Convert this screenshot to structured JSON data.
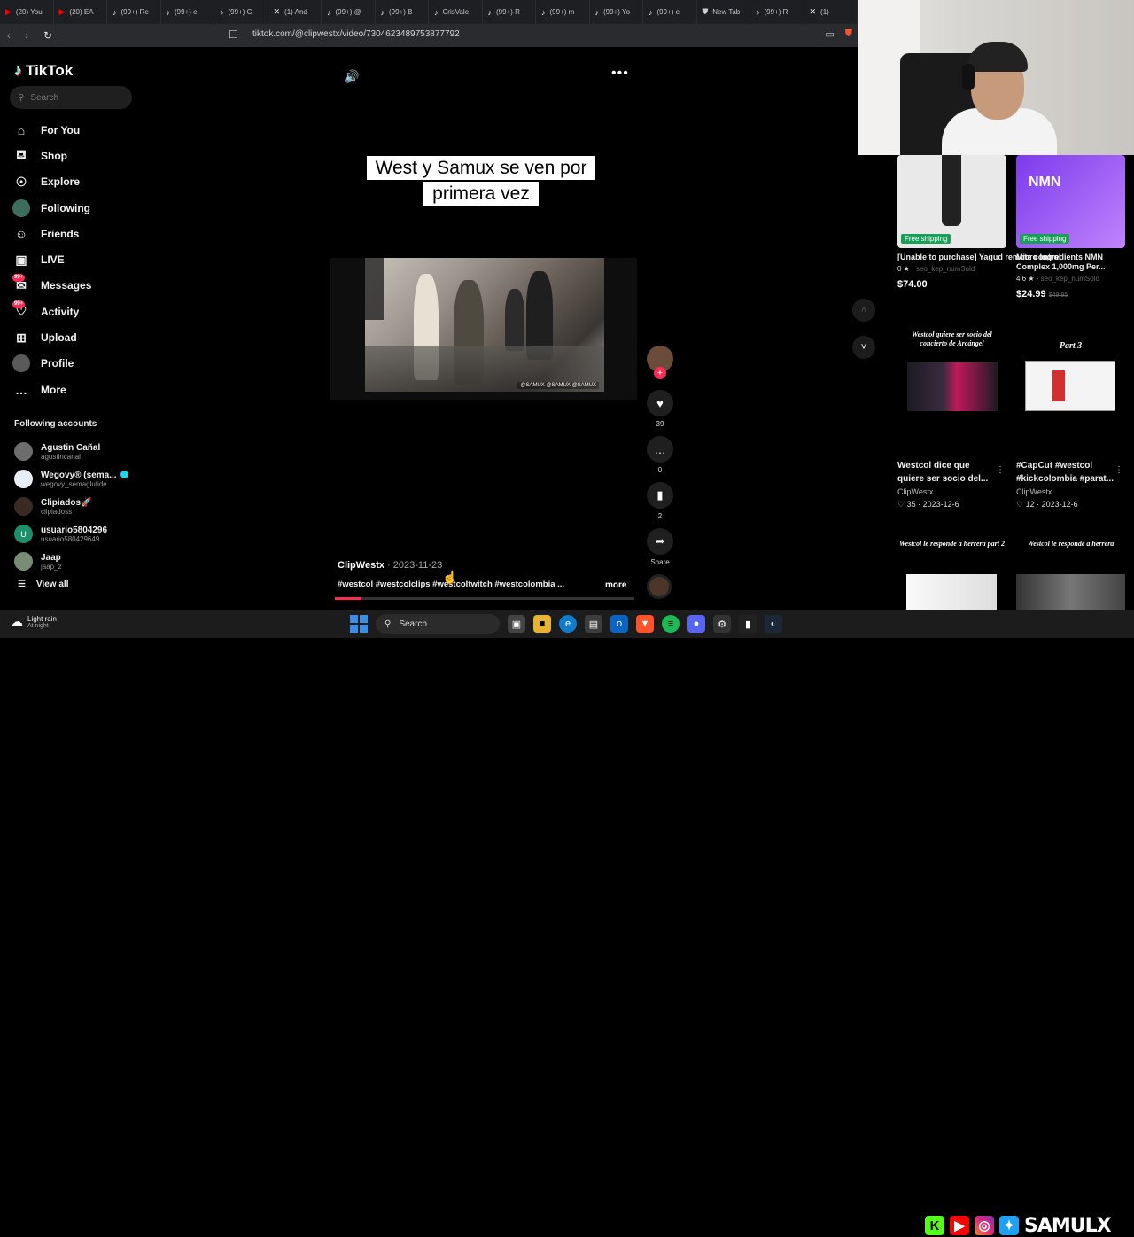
{
  "browser": {
    "tabs": [
      {
        "icon": "youtube-icon",
        "label": "(20) You",
        "color": "#ff0000"
      },
      {
        "icon": "youtube-icon",
        "label": "(20) EA",
        "color": "#ff0000"
      },
      {
        "icon": "tiktok-icon",
        "label": "(99+) Re",
        "color": "#ffffff"
      },
      {
        "icon": "tiktok-icon",
        "label": "(99+) el",
        "color": "#ffffff"
      },
      {
        "icon": "tiktok-icon",
        "label": "(99+) G",
        "color": "#ffffff"
      },
      {
        "icon": "x-icon",
        "label": "(1) And",
        "color": "#ffffff"
      },
      {
        "icon": "tiktok-icon",
        "label": "(99+) @",
        "color": "#ffffff"
      },
      {
        "icon": "tiktok-icon",
        "label": "(99+) B",
        "color": "#ffffff"
      },
      {
        "icon": "tiktok-icon",
        "label": "CrisVale",
        "color": "#ffffff"
      },
      {
        "icon": "tiktok-icon",
        "label": "(99+) R",
        "color": "#ffffff"
      },
      {
        "icon": "tiktok-icon",
        "label": "(99+) m",
        "color": "#ffffff"
      },
      {
        "icon": "tiktok-icon",
        "label": "(99+) Yo",
        "color": "#ffffff"
      },
      {
        "icon": "tiktok-icon",
        "label": "(99+) e",
        "color": "#ffffff"
      },
      {
        "icon": "brave-icon",
        "label": "New Tab",
        "color": "#cccccc"
      },
      {
        "icon": "tiktok-icon",
        "label": "(99+) R",
        "color": "#ffffff"
      },
      {
        "icon": "x-icon",
        "label": "(1)",
        "color": "#ffffff"
      }
    ],
    "url": "tiktok.com/@clipwestx/video/7304623489753877792"
  },
  "sidebar": {
    "logo": "TikTok",
    "search_placeholder": "Search",
    "menu": [
      {
        "label": "For You",
        "icon": "home-icon"
      },
      {
        "label": "Shop",
        "icon": "shopping-bag-icon"
      },
      {
        "label": "Explore",
        "icon": "compass-icon"
      },
      {
        "label": "Following",
        "icon": "following-avatar-icon"
      },
      {
        "label": "Friends",
        "icon": "friends-icon"
      },
      {
        "label": "LIVE",
        "icon": "live-icon"
      },
      {
        "label": "Messages",
        "icon": "messages-icon",
        "badge": "99+"
      },
      {
        "label": "Activity",
        "icon": "activity-icon",
        "badge": "99+"
      },
      {
        "label": "Upload",
        "icon": "upload-icon"
      },
      {
        "label": "Profile",
        "icon": "profile-avatar-icon"
      },
      {
        "label": "More",
        "icon": "more-icon"
      }
    ],
    "following_title": "Following accounts",
    "following": [
      {
        "name": "Agustin Cañal",
        "handle": "agustincanal",
        "verified": false
      },
      {
        "name": "Wegovy® (sema...",
        "handle": "wegovy_semaglutide",
        "verified": true
      },
      {
        "name": "Clipiados🚀",
        "handle": "clipiadoss",
        "verified": false
      },
      {
        "name": "usuario5804296",
        "handle": "usuario5804296​49",
        "verified": false,
        "initial": "U"
      },
      {
        "name": "Jaap",
        "handle": "jaap_z",
        "verified": false
      }
    ],
    "view_all": "View all"
  },
  "video": {
    "caption_line1": "West y Samux se ven por",
    "caption_line2": "primera vez",
    "watermark": "@SAMUX @SAMUX @SAMUX",
    "creator": "ClipWestx",
    "date": " · 2023-11-23",
    "hashtags": "#westcol #westcolclips #westcoltwitch #westcolombia ...",
    "more": "more",
    "progress": 0.09,
    "likes": "39",
    "comments": "0",
    "saves": "2",
    "share": "Share"
  },
  "products": [
    {
      "title": "[Unable to purchase] Yagud remote control",
      "rating": "0 ★",
      "sold": "seo_kep_numSold",
      "price": "$74.00",
      "strike": "",
      "ship": "Free shipping"
    },
    {
      "title": "Micro Ingredients NMN Complex 1,000mg Per...",
      "rating": "4.6 ★",
      "sold": "seo_kep_numSold",
      "price": "$24.99",
      "strike": "$49.95",
      "ship": "Free shipping",
      "img_text": "NMN"
    }
  ],
  "related": [
    {
      "thumb_title": "Westcol quiere ser socio del concierto de Arcángel",
      "title": "Westcol dice que quiere ser socio del...",
      "user": "ClipWestx",
      "stats": "♡ 35 · 2023-12-6"
    },
    {
      "thumb_title": "Part 3",
      "title": "#CapCut #westcol #kickcolombia #parat...",
      "user": "ClipWestx",
      "stats": "♡ 12 · 2023-12-6"
    },
    {
      "thumb_title": "Westcol le responde a herrera part 2"
    },
    {
      "thumb_title": "Westcol le responde a herrera"
    }
  ],
  "taskbar": {
    "weather_line1": "Light rain",
    "weather_line2": "At night",
    "search": "Search"
  },
  "overlay": {
    "brand": "SAMULX"
  },
  "colors": {
    "accent": "#fe2c55",
    "brave": "#fb542b",
    "windows_blue": "#3a8ee6"
  }
}
